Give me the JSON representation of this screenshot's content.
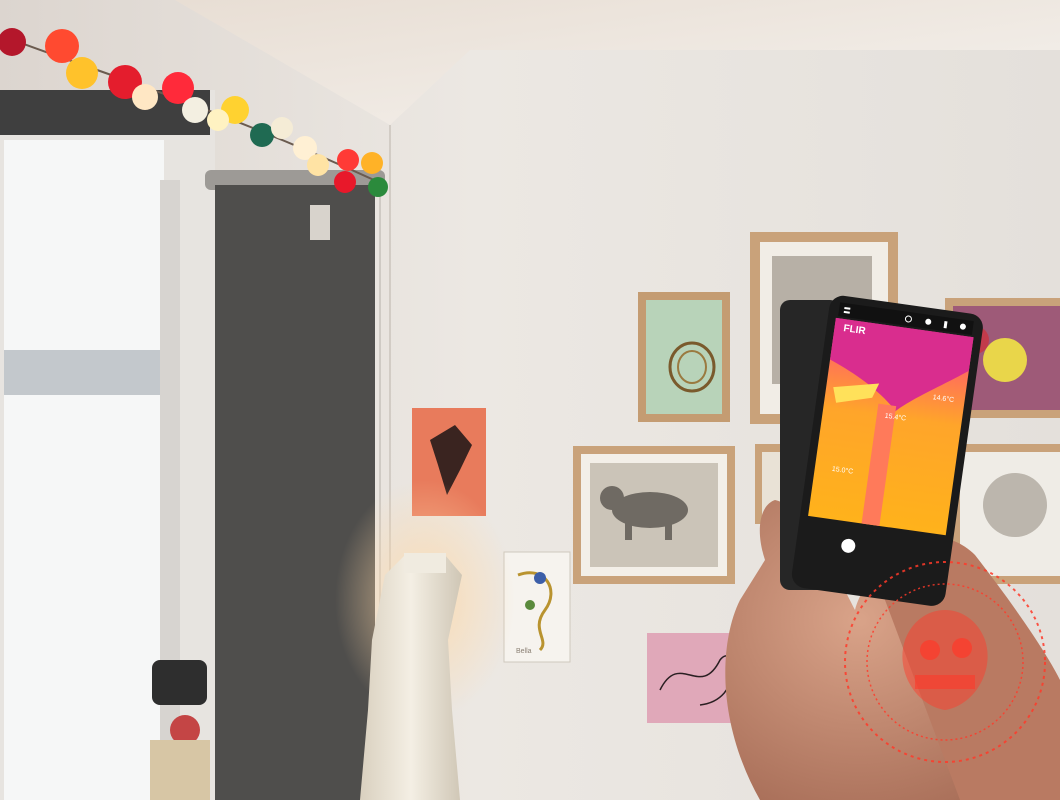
{
  "photo": {
    "phone_screen": {
      "logo_text": "FLIR",
      "spot_labels": [
        "15.4°C",
        "14.6°C",
        "15.0°C"
      ]
    },
    "drawing_caption": "Bella"
  },
  "colors": {
    "wall": "#e9e5e0",
    "ceiling": "#f3efeb",
    "blind": "#4f4e4c",
    "frame_wood": "#c9a27a",
    "thermal_hot": "#ffb31a",
    "thermal_mid": "#ff6a3d",
    "thermal_cool": "#e4328c",
    "seal_red": "#ff3a2a"
  }
}
